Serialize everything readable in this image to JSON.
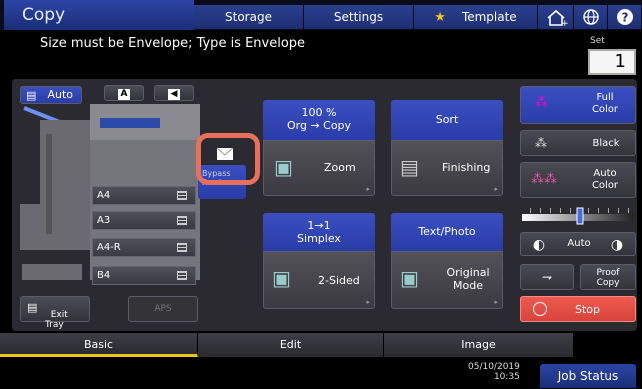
{
  "topbar": {
    "title": "Copy",
    "storage": "Storage",
    "settings": "Settings",
    "template": "Template"
  },
  "message": "Size must be Envelope; Type is Envelope",
  "set": {
    "label": "Set",
    "value": "1"
  },
  "paper": {
    "auto_label": "Auto",
    "letter_a": "A",
    "bypass_label": "Bypass Feed",
    "trays": [
      "A4",
      "A3",
      "A4-R",
      "B4"
    ],
    "exit_tray_label": "Exit\nTray",
    "aps_label": "APS"
  },
  "functions": {
    "zoom_header": "100 %",
    "zoom_sub": "Org  →  Copy",
    "zoom_label": "Zoom",
    "sort_header": "Sort",
    "finishing_label": "Finishing",
    "sided_header": "1→1",
    "sided_sub": "Simplex",
    "sided_label": "2-Sided",
    "mode_header": "Text/Photo",
    "mode_label": "Original\nMode"
  },
  "color": {
    "full_color": "Full\nColor",
    "black": "Black",
    "auto_color": "Auto\nColor",
    "density_auto": "Auto",
    "proof_copy": "Proof\nCopy",
    "stop": "Stop"
  },
  "tabs": [
    "Basic",
    "Edit",
    "Image"
  ],
  "status": {
    "date": "05/10/2019",
    "time": "10:35",
    "job_status": "Job Status"
  },
  "colors": {
    "accent_blue": "#2a3ca8",
    "stop_red": "#e0504a",
    "highlight_orange": "#e8705a",
    "active_tab_line": "#f0c419"
  }
}
